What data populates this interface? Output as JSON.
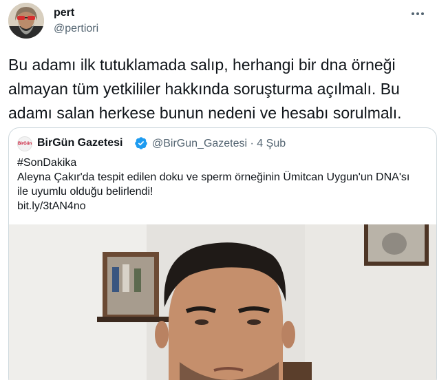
{
  "author": {
    "name": "pert",
    "handle": "@pertiori"
  },
  "tweet": {
    "text": "Bu adamı ilk tutuklamada salıp, herhangi bir dna örneği\nalmayan tüm yetkililer hakkında soruşturma açılmalı. Bu\nadamı salan herkese bunun nedeni ve hesabı sorulmalı."
  },
  "quoted_tweet": {
    "avatar_text": "BirGün",
    "name": "BirGün Gazetesi",
    "handle_date": "@BirGun_Gazetesi · 4 Şub",
    "text": "#SonDakika\nAleyna Çakır'da tespit edilen doku ve sperm örneğinin Ümitcan Uygun'un DNA'sı\nile uyumlu olduğu belirlendi!\nbit.ly/3tAN4no"
  },
  "colors": {
    "text_primary": "#0f1419",
    "text_secondary": "#536471",
    "border": "#cfd9de",
    "verified": "#1d9bf0"
  },
  "icons": {
    "more": "more-horizontal-icon",
    "verified": "verified-badge-icon"
  }
}
